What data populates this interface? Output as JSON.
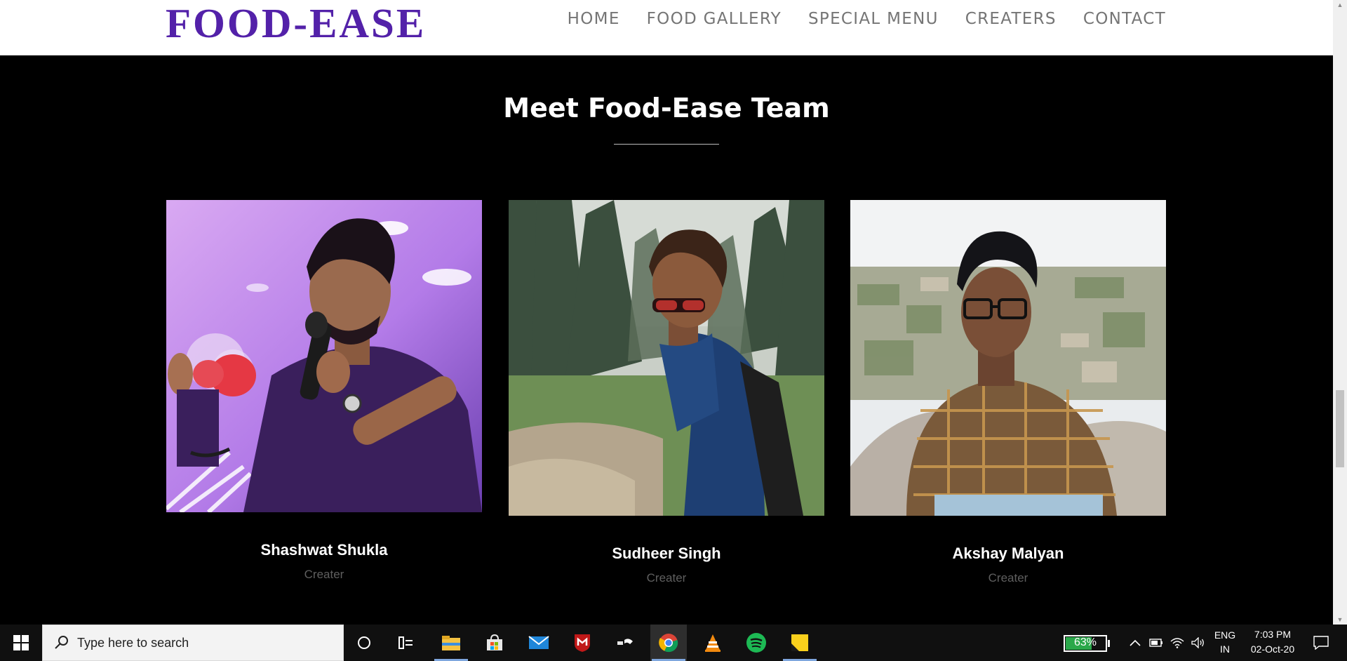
{
  "brand": {
    "title": "FOOD-EASE",
    "color": "#5321a9"
  },
  "nav": {
    "items": [
      {
        "label": "HOME"
      },
      {
        "label": "FOOD GALLERY"
      },
      {
        "label": "SPECIAL MENU"
      },
      {
        "label": "CREATERS"
      },
      {
        "label": "CONTACT"
      }
    ]
  },
  "section": {
    "title": "Meet Food-Ease Team"
  },
  "team": [
    {
      "name": "Shashwat Shukla",
      "role": "Creater",
      "photo": "person-with-microphone-photo"
    },
    {
      "name": "Sudheer Singh",
      "role": "Creater",
      "photo": "person-in-forest-photo"
    },
    {
      "name": "Akshay Malyan",
      "role": "Creater",
      "photo": "person-on-hilltop-photo"
    }
  ],
  "taskbar": {
    "search_placeholder": "Type here to search",
    "apps": [
      "cortana-icon",
      "task-view-icon",
      "file-explorer-icon",
      "store-icon",
      "mail-icon",
      "mcafee-icon",
      "media-app-icon",
      "chrome-icon",
      "vlc-icon",
      "spotify-icon",
      "sticky-notes-icon"
    ],
    "battery_percent": "63%",
    "battery_level": 0.63,
    "language": "ENG",
    "region": "IN",
    "time": "7:03 PM",
    "date": "02-Oct-20"
  }
}
